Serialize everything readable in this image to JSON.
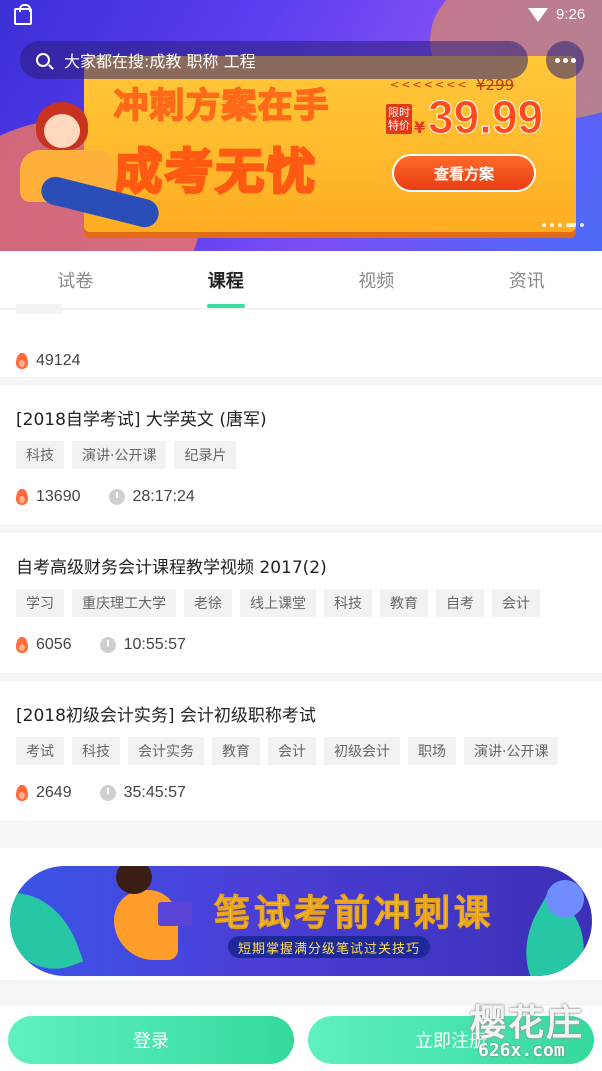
{
  "status_bar": {
    "time": "9:26"
  },
  "search": {
    "placeholder_text": "大家都在搜:成教 职称 工程"
  },
  "banner": {
    "headline1": "冲刺方案在手",
    "headline2": "成考无忧",
    "old_price": "¥299",
    "price_tag": "限时特价",
    "currency": "¥",
    "price": "39.99",
    "button_label": "查看方案"
  },
  "tabs": [
    {
      "label": "试卷",
      "active": false
    },
    {
      "label": "课程",
      "active": true
    },
    {
      "label": "视频",
      "active": false
    },
    {
      "label": "资讯",
      "active": false
    }
  ],
  "partial_card": {
    "views": "49124"
  },
  "courses": [
    {
      "title": "[2018自学考试] 大学英文 (唐军)",
      "tags": [
        "科技",
        "演讲·公开课",
        "纪录片"
      ],
      "views": "13690",
      "duration": "28:17:24"
    },
    {
      "title": "自考高级财务会计课程教学视频 2017(2)",
      "tags": [
        "学习",
        "重庆理工大学",
        "老徐",
        "线上课堂",
        "科技",
        "教育",
        "自考",
        "会计"
      ],
      "views": "6056",
      "duration": "10:55:57"
    },
    {
      "title": "[2018初级会计实务] 会计初级职称考试",
      "tags": [
        "考试",
        "科技",
        "会计实务",
        "教育",
        "会计",
        "初级会计",
        "职场",
        "演讲·公开课"
      ],
      "views": "2649",
      "duration": "35:45:57"
    }
  ],
  "promo": {
    "title": "笔试考前冲刺课",
    "subtitle": "短期掌握满分级笔试过关技巧"
  },
  "bottom": {
    "login_label": "登录",
    "register_label": "立即注册"
  },
  "watermark": {
    "text": "樱花庄",
    "sub": "626x.com"
  },
  "colors": {
    "accent": "#3bdc9f",
    "button": "#45e0ad",
    "fire": "#ff6b3a"
  }
}
